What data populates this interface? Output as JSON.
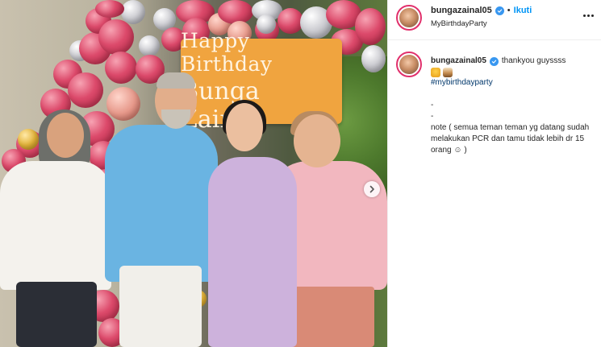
{
  "post": {
    "photo_alt": "",
    "banner": {
      "line1": "Happy Birthday",
      "line2": "Bunga Zainal"
    }
  },
  "header": {
    "username": "bungazainal05",
    "separator": "•",
    "follow_label": "Ikuti",
    "location": "MyBirthdayParty"
  },
  "caption": {
    "username": "bungazainal05",
    "text": "thankyou guyssss",
    "hashtag": "#mybirthdayparty",
    "dash1": "-",
    "dash2": "-",
    "note": "note ( semua teman teman yg datang sudah melakukan PCR dan tamu tidak lebih dr 15 orang ☺ )"
  },
  "icons": {
    "verified": "verified-badge-icon",
    "more": "more-options-icon",
    "next": "chevron-right-icon"
  },
  "colors": {
    "accent": "#0095f6",
    "hashtag": "#00376b",
    "story_ring": "#e1306c",
    "banner": "#f0a43f"
  }
}
